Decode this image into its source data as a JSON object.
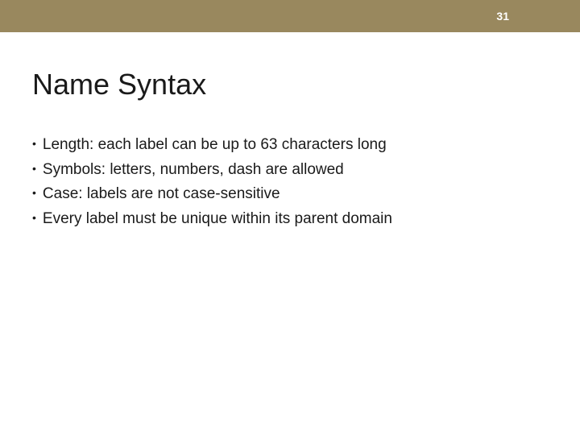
{
  "header": {
    "page_number": "31"
  },
  "title": "Name Syntax",
  "bullets": [
    "Length:  each label can be up to 63 characters long",
    "Symbols:  letters, numbers, dash are allowed",
    "Case:  labels are not case-sensitive",
    "Every label must be unique within its parent domain"
  ]
}
